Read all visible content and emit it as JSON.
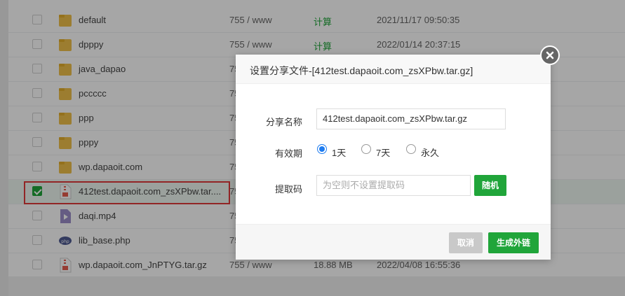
{
  "files": [
    {
      "name": "default",
      "perm": "755 / www",
      "size": "计算",
      "size_is_link": true,
      "date": "2021/11/17 09:50:35",
      "type": "folder",
      "checked": false
    },
    {
      "name": "dpppy",
      "perm": "755 / www",
      "size": "计算",
      "size_is_link": true,
      "date": "2022/01/14 20:37:15",
      "type": "folder",
      "checked": false
    },
    {
      "name": "java_dapao",
      "perm": "75",
      "size": "",
      "size_is_link": false,
      "date": "",
      "type": "folder",
      "checked": false
    },
    {
      "name": "pccccc",
      "perm": "75",
      "size": "",
      "size_is_link": false,
      "date": "",
      "type": "folder",
      "checked": false
    },
    {
      "name": "ppp",
      "perm": "75",
      "size": "",
      "size_is_link": false,
      "date": "",
      "type": "folder",
      "checked": false
    },
    {
      "name": "pppy",
      "perm": "75",
      "size": "",
      "size_is_link": false,
      "date": "",
      "type": "folder",
      "checked": false
    },
    {
      "name": "wp.dapaoit.com",
      "perm": "75",
      "size": "",
      "size_is_link": false,
      "date": "",
      "type": "folder",
      "checked": false
    },
    {
      "name": "412test.dapaoit.com_zsXPbw.tar....",
      "perm": "75",
      "size": "",
      "size_is_link": false,
      "date": "",
      "type": "archive",
      "checked": true
    },
    {
      "name": "daqi.mp4",
      "perm": "75",
      "size": "",
      "size_is_link": false,
      "date": "",
      "type": "video",
      "checked": false
    },
    {
      "name": "lib_base.php",
      "perm": "75",
      "size": "",
      "size_is_link": false,
      "date": "",
      "type": "php",
      "checked": false
    },
    {
      "name": "wp.dapaoit.com_JnPTYG.tar.gz",
      "perm": "755 / www",
      "size": "18.88 MB",
      "size_is_link": false,
      "date": "2022/04/08 16:55:36",
      "type": "archive",
      "checked": false
    }
  ],
  "dialog": {
    "title": "设置分享文件-[412test.dapaoit.com_zsXPbw.tar.gz]",
    "share_name_label": "分享名称",
    "share_name_value": "412test.dapaoit.com_zsXPbw.tar.gz",
    "validity_label": "有效期",
    "validity_options": [
      "1天",
      "7天",
      "永久"
    ],
    "validity_selected": "1天",
    "code_label": "提取码",
    "code_placeholder": "为空则不设置提取码",
    "random_button": "随机",
    "cancel_button": "取消",
    "generate_button": "生成外链"
  },
  "icons": {
    "folder": "folder-icon",
    "archive": "archive-file-icon",
    "video": "video-file-icon",
    "php": "php-file-icon",
    "close": "close-icon"
  },
  "colors": {
    "accent_green": "#20a53a",
    "radio_blue": "#1e7cf0",
    "highlight_red": "#e03a3a",
    "folder": "#f0c14b"
  }
}
